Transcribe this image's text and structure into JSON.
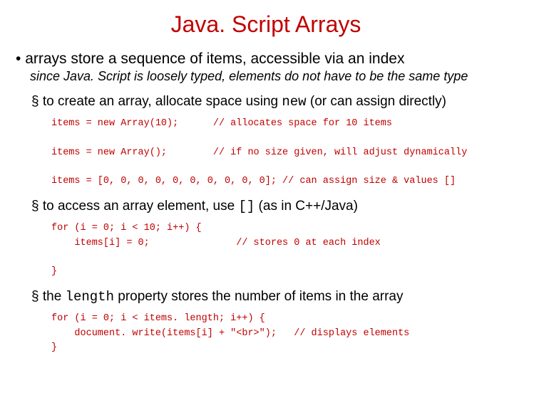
{
  "title": "Java. Script Arrays",
  "b1": {
    "text": "arrays store a sequence of items, accessible via an index",
    "sub": "since Java. Script is loosely typed, elements do not have to be the same type"
  },
  "sec1": {
    "pre": "to create an array, allocate space using ",
    "code": "new",
    "post": "   (or can assign directly)",
    "block": "items = new Array(10);      // allocates space for 10 items\n\nitems = new Array();        // if no size given, will adjust dynamically\n\nitems = [0, 0, 0, 0, 0, 0, 0, 0, 0, 0]; // can assign size & values []"
  },
  "sec2": {
    "pre": "to access an array element, use ",
    "code": "[]",
    "post": " (as in C++/Java)",
    "block": "for (i = 0; i < 10; i++) {\n    items[i] = 0;               // stores 0 at each index\n\n}"
  },
  "sec3": {
    "pre": "the ",
    "code": "length",
    "post": " property stores the number of items in the array",
    "block": "for (i = 0; i < items. length; i++) {\n    document. write(items[i] + \"<br>\");   // displays elements\n}"
  }
}
